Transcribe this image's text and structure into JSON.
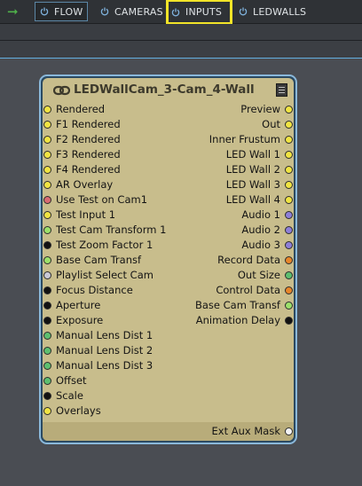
{
  "toolbar": {
    "tabs": [
      {
        "label": "FLOW"
      },
      {
        "label": "CAMERAS"
      },
      {
        "label": "INPUTS"
      },
      {
        "label": "LEDWALLS"
      }
    ]
  },
  "node": {
    "title": "LEDWallCam_3-Cam_4-Wall",
    "inputs": [
      {
        "label": "Rendered",
        "color": "#f0e442"
      },
      {
        "label": "F1 Rendered",
        "color": "#f0e442"
      },
      {
        "label": "F2 Rendered",
        "color": "#f0e442"
      },
      {
        "label": "F3 Rendered",
        "color": "#f0e442"
      },
      {
        "label": "F4 Rendered",
        "color": "#f0e442"
      },
      {
        "label": "AR Overlay",
        "color": "#f0e442"
      },
      {
        "label": "Use Test on Cam1",
        "color": "#d96b72"
      },
      {
        "label": "Test Input 1",
        "color": "#f0e442"
      },
      {
        "label": "Test Cam Transform 1",
        "color": "#9ce06a"
      },
      {
        "label": "Test Zoom Factor 1",
        "color": "#111111"
      },
      {
        "label": "Base Cam Transf",
        "color": "#9ce06a"
      },
      {
        "label": "Playlist Select Cam",
        "color": "#c9c9d6"
      },
      {
        "label": "Focus Distance",
        "color": "#111111"
      },
      {
        "label": "Aperture",
        "color": "#111111"
      },
      {
        "label": "Exposure",
        "color": "#111111"
      },
      {
        "label": "Manual Lens Dist 1",
        "color": "#5dbf6f"
      },
      {
        "label": "Manual Lens Dist 2",
        "color": "#5dbf6f"
      },
      {
        "label": "Manual Lens Dist 3",
        "color": "#5dbf6f"
      },
      {
        "label": "Offset",
        "color": "#5dbf6f"
      },
      {
        "label": "Scale",
        "color": "#111111"
      },
      {
        "label": "Overlays",
        "color": "#f0e442"
      }
    ],
    "outputs": [
      {
        "label": "Preview",
        "color": "#f0e442"
      },
      {
        "label": "Out",
        "color": "#f0e442"
      },
      {
        "label": "Inner Frustum",
        "color": "#f0e442"
      },
      {
        "label": "LED Wall 1",
        "color": "#f0e442"
      },
      {
        "label": "LED Wall 2",
        "color": "#f0e442"
      },
      {
        "label": "LED Wall 3",
        "color": "#f0e442"
      },
      {
        "label": "LED Wall 4",
        "color": "#f0e442"
      },
      {
        "label": "Audio 1",
        "color": "#8e7fd8"
      },
      {
        "label": "Audio 2",
        "color": "#8e7fd8"
      },
      {
        "label": "Audio 3",
        "color": "#8e7fd8"
      },
      {
        "label": "Record Data",
        "color": "#e8862a"
      },
      {
        "label": "Out Size",
        "color": "#5dbf6f"
      },
      {
        "label": "Control Data",
        "color": "#e8862a"
      },
      {
        "label": "Base Cam Transf",
        "color": "#9ce06a"
      },
      {
        "label": "Animation Delay",
        "color": "#111111"
      }
    ],
    "footer_output": {
      "label": "Ext Aux Mask",
      "color": "#f4f4f4"
    }
  }
}
